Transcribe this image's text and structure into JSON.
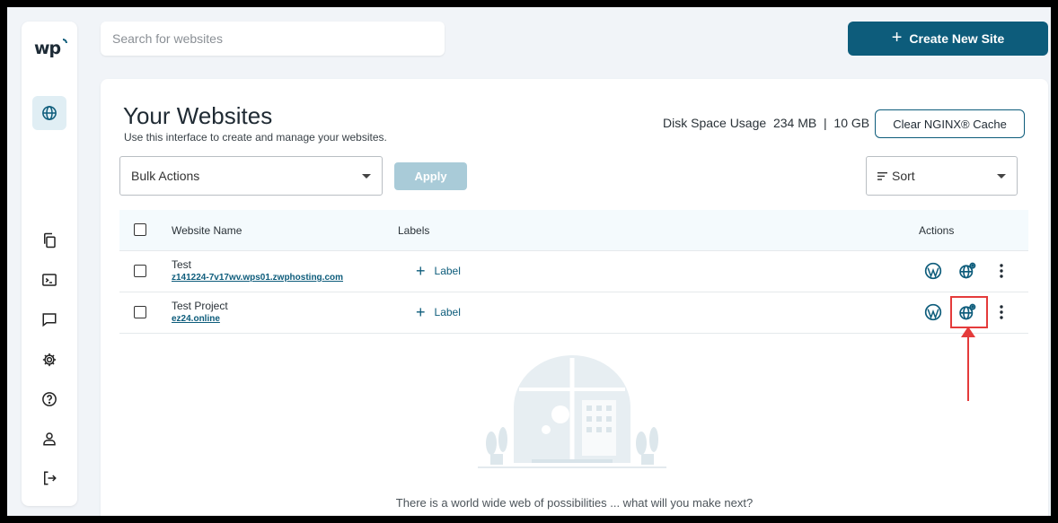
{
  "brand": {
    "logo": "wp"
  },
  "search": {
    "placeholder": "Search for websites"
  },
  "header": {
    "create_button": "Create New Site"
  },
  "main": {
    "title": "Your Websites",
    "subtitle": "Use this interface to create and manage your websites.",
    "disk_label": "Disk Space Usage",
    "disk_used": "234 MB",
    "disk_separator": "|",
    "disk_total": "10 GB",
    "clear_cache_button": "Clear NGINX® Cache"
  },
  "toolbar": {
    "bulk_actions": "Bulk Actions",
    "apply": "Apply",
    "sort": "Sort"
  },
  "table": {
    "columns": {
      "name": "Website Name",
      "labels": "Labels",
      "actions": "Actions"
    },
    "rows": [
      {
        "name": "Test",
        "url": "z141224-7v17wv.wps01.zwphosting.com",
        "label_action": "Label"
      },
      {
        "name": "Test Project",
        "url": "ez24.online",
        "label_action": "Label"
      }
    ]
  },
  "empty_state": {
    "message": "There is a world wide web of possibilities ... what will you make next?"
  },
  "colors": {
    "accent": "#0d5c7b",
    "highlight": "#e43b3b",
    "apply_disabled": "#a9cbd8"
  }
}
